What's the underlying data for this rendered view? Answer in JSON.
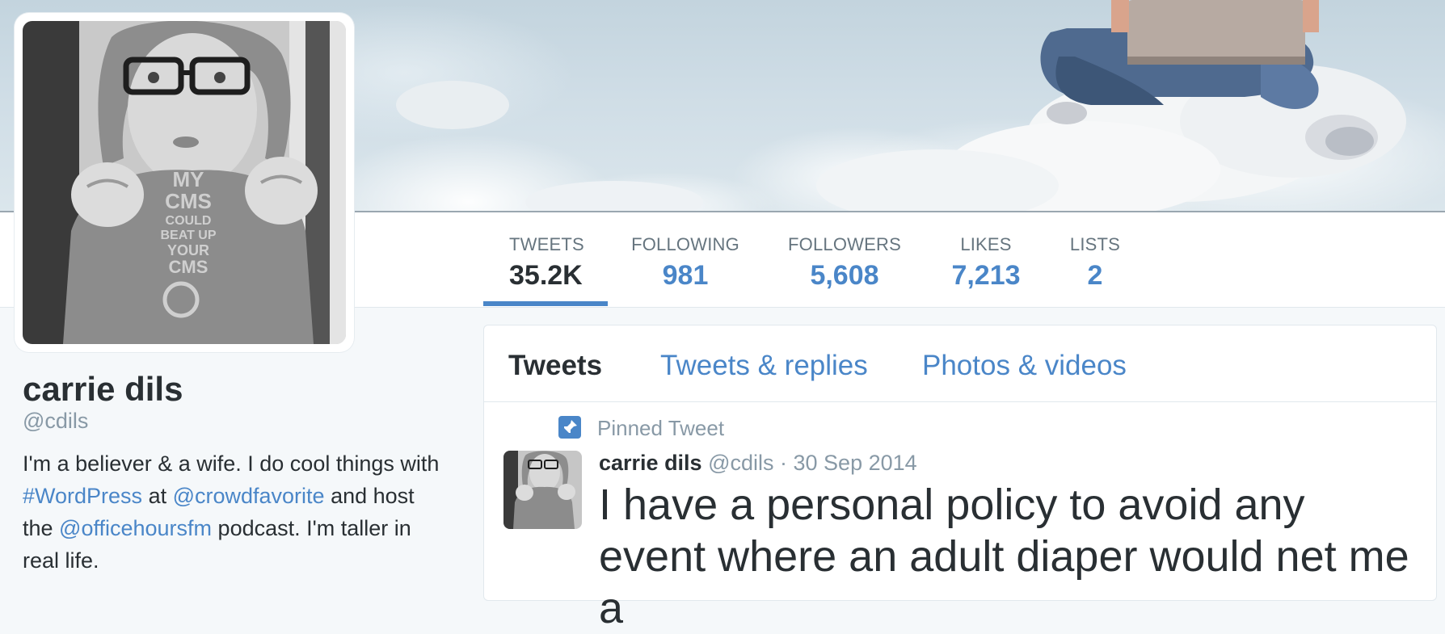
{
  "profile": {
    "name": "carrie dils",
    "handle": "@cdils",
    "bio": {
      "part1": "I'm a believer & a wife. I do cool things with ",
      "hashtag": "#WordPress",
      "part2": " at ",
      "mention1": "@crowdfavorite",
      "part3": " and host the ",
      "mention2": "@officehoursfm",
      "part4": " podcast. I'm taller in real life."
    },
    "shirt_text": [
      "MY",
      "CMS",
      "COULD",
      "BEAT UP",
      "YOUR",
      "CMS"
    ]
  },
  "stats": [
    {
      "label": "TWEETS",
      "value": "35.2K"
    },
    {
      "label": "FOLLOWING",
      "value": "981"
    },
    {
      "label": "FOLLOWERS",
      "value": "5,608"
    },
    {
      "label": "LIKES",
      "value": "7,213"
    },
    {
      "label": "LISTS",
      "value": "2"
    }
  ],
  "timeline": {
    "tabs": [
      "Tweets",
      "Tweets & replies",
      "Photos & videos"
    ],
    "active_tab": "Tweets",
    "pinned_label": "Pinned Tweet",
    "tweet": {
      "name": "carrie dils",
      "handle": "@cdils",
      "separator": " · ",
      "date": "30 Sep 2014",
      "text": "I have a personal policy to avoid any event where an adult diaper would net me a"
    }
  },
  "colors": {
    "link": "#4a86c8",
    "text": "#292f33",
    "muted": "#8899a6",
    "page_bg": "#f5f8fa"
  },
  "icons": {
    "pin": "pin-icon"
  }
}
